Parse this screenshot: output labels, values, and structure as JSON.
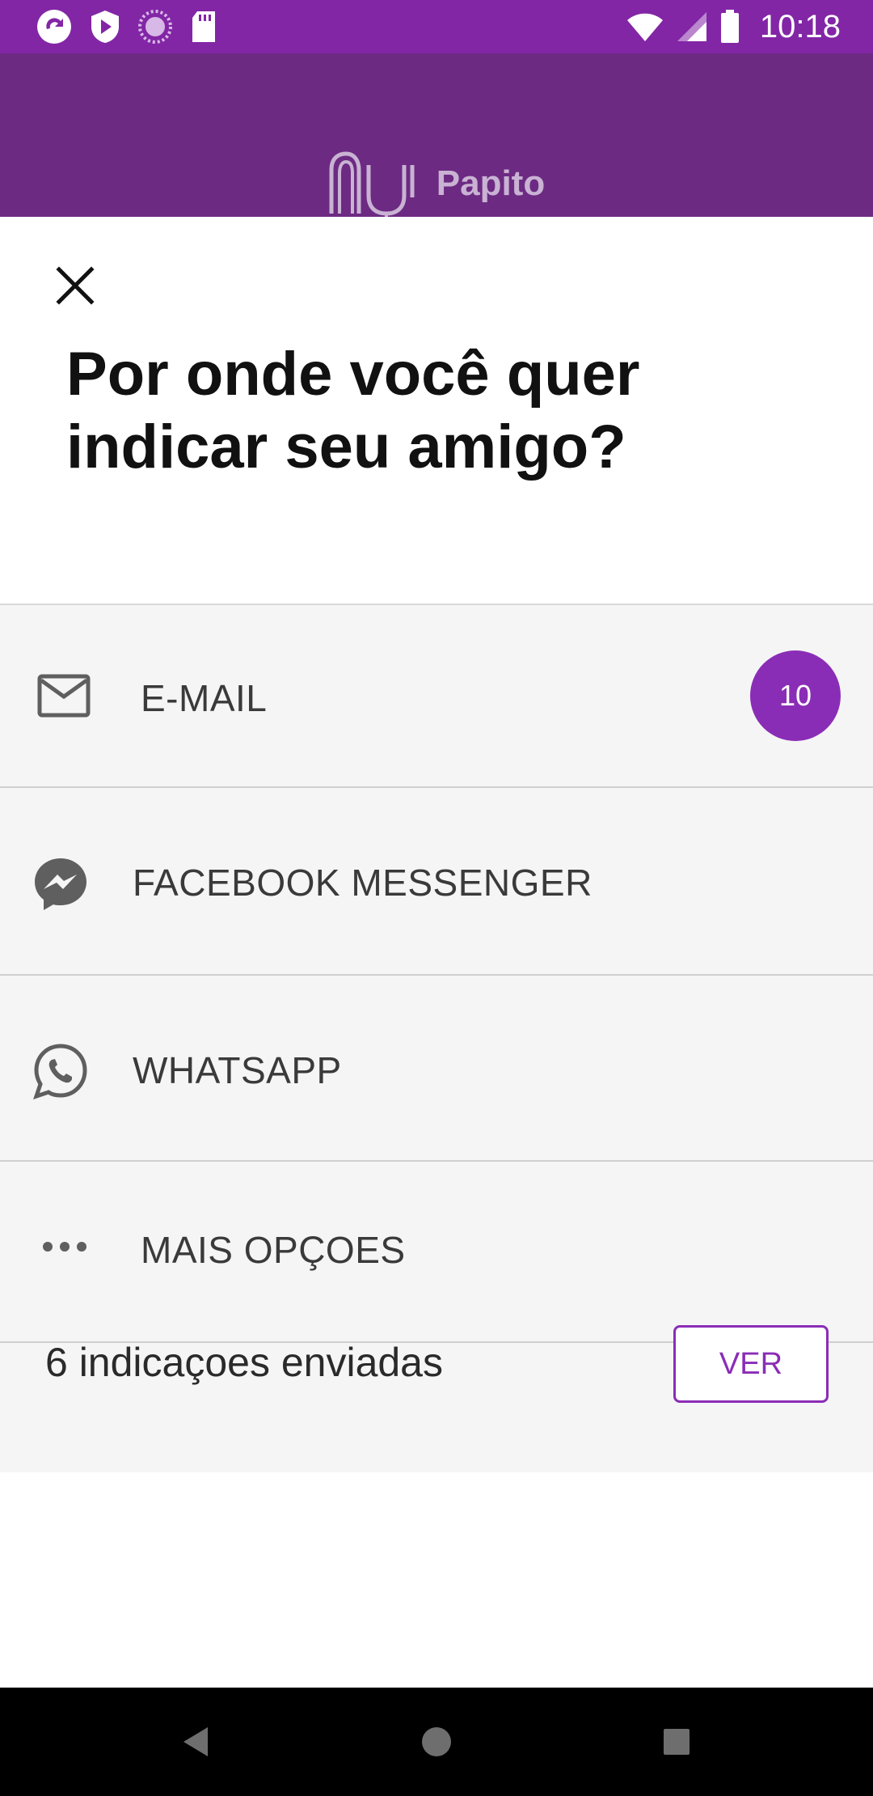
{
  "status_bar": {
    "time": "10:18",
    "left_icons": [
      "sync-icon",
      "shield-play-icon",
      "circle-dots-icon",
      "sd-card-icon"
    ],
    "right_icons": [
      "wifi-icon",
      "cell-signal-icon",
      "battery-icon"
    ]
  },
  "header": {
    "brand": "Papito",
    "logo_icon": "nubank-logo-icon"
  },
  "sheet": {
    "close_icon": "close-icon",
    "title_parts": {
      "p1": "Por ",
      "b1": "onde",
      "p2": "  você quer ",
      "b2": "indicar",
      "p3": " seu amigo?"
    }
  },
  "options": [
    {
      "label": "E-MAIL",
      "icon": "mail-icon",
      "badge": "10"
    },
    {
      "label": "FACEBOOK MESSENGER",
      "icon": "messenger-icon"
    },
    {
      "label": "WHATSAPP",
      "icon": "whatsapp-icon"
    },
    {
      "label": "MAIS OPÇOES",
      "icon": "more-horizontal-icon"
    }
  ],
  "footer": {
    "sent_text": "6 indicaçoes enviadas",
    "ver_label": "VER"
  },
  "colors": {
    "status_bar": "#8226a6",
    "header": "#6c2a82",
    "accent": "#8a2db6",
    "options_bg": "#f5f5f5"
  }
}
